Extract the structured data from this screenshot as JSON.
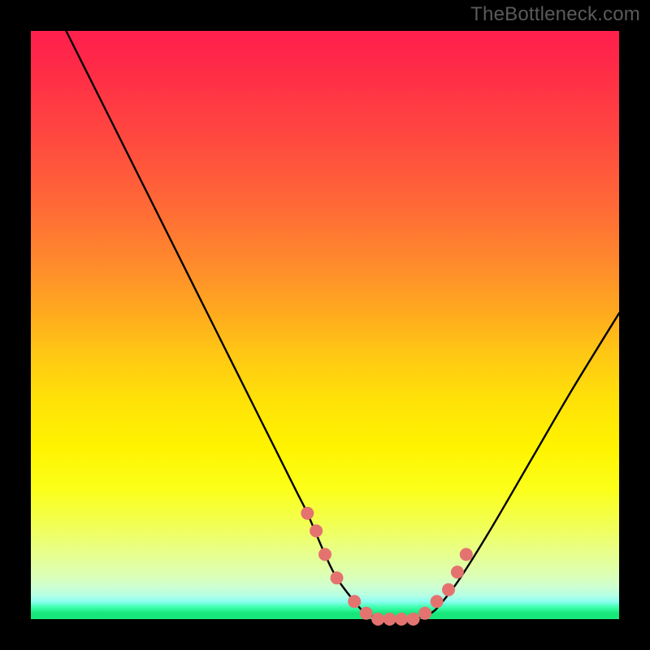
{
  "watermark": "TheBottleneck.com",
  "chart_data": {
    "type": "line",
    "title": "",
    "xlabel": "",
    "ylabel": "",
    "xlim": [
      0,
      100
    ],
    "ylim": [
      0,
      100
    ],
    "grid": false,
    "legend": false,
    "background_gradient": [
      "#ff1f4d",
      "#ffaa1e",
      "#fff400",
      "#17e77a"
    ],
    "series": [
      {
        "name": "bottleneck-curve",
        "color": "#000000",
        "x": [
          6,
          10,
          15,
          20,
          25,
          30,
          35,
          40,
          45,
          47,
          50,
          52,
          55,
          57,
          60,
          62,
          65,
          68,
          70,
          73,
          78,
          85,
          92,
          100
        ],
        "y": [
          100,
          92,
          82,
          72,
          62,
          52,
          42,
          32,
          22,
          18,
          11,
          7,
          3,
          1,
          0,
          0,
          0,
          1,
          3,
          7,
          15,
          27,
          39,
          52
        ]
      }
    ],
    "markers": [
      {
        "name": "sample-dots",
        "color": "#e4736f",
        "radius_px": 8,
        "x": [
          47,
          48.5,
          50,
          52,
          55,
          57,
          59,
          61,
          63,
          65,
          67,
          69,
          71,
          72.5,
          74
        ],
        "y": [
          18,
          15,
          11,
          7,
          3,
          1,
          0,
          0,
          0,
          0,
          1,
          3,
          5,
          8,
          11
        ]
      }
    ]
  }
}
